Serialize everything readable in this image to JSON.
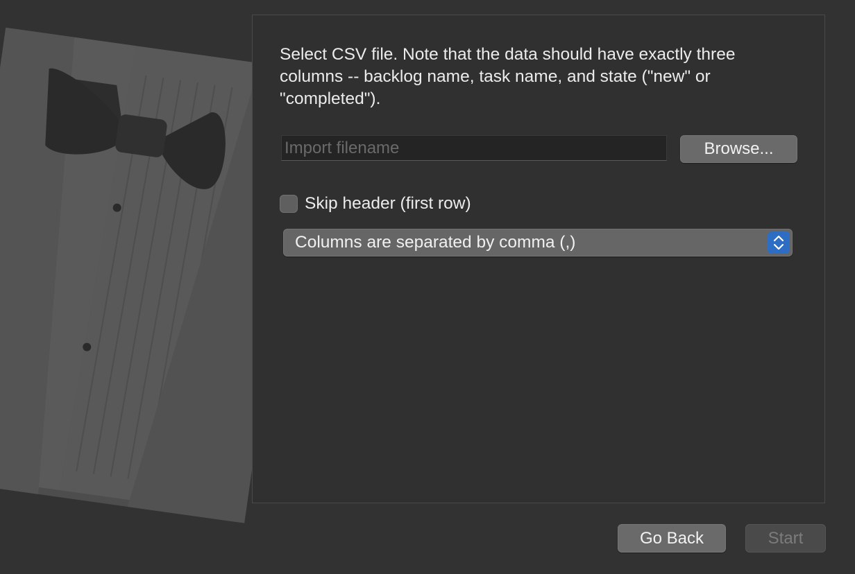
{
  "instructions": "Select CSV file. Note that the data should have exactly three columns -- backlog name, task name, and state (\"new\" or \"completed\").",
  "file_input": {
    "placeholder": "Import filename",
    "value": ""
  },
  "browse_label": "Browse...",
  "skip_header": {
    "label": "Skip header (first row)",
    "checked": false
  },
  "separator_select": {
    "selected": "Columns are separated by comma (,)"
  },
  "footer": {
    "go_back_label": "Go Back",
    "start_label": "Start"
  },
  "colors": {
    "background": "#323232",
    "accent": "#2d6dc4"
  },
  "icons": [
    "tuxedo-illustration",
    "chevron-up-down-icon"
  ]
}
